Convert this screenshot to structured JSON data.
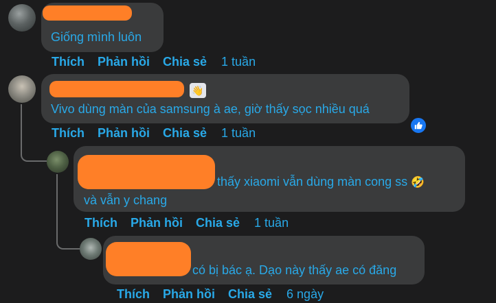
{
  "comments": [
    {
      "text_lines": [
        "Giống mình luôn"
      ],
      "actions": {
        "like": "Thích",
        "reply": "Phản hồi",
        "share": "Chia sẻ",
        "time": "1 tuần"
      }
    },
    {
      "text_lines": [
        "Vivo dùng màn của samsung à ae, giờ thấy sọc nhiều quá"
      ],
      "actions": {
        "like": "Thích",
        "reply": "Phản hồi",
        "share": "Chia sẻ",
        "time": "1 tuần"
      }
    },
    {
      "text_lines": [
        "thấy xiaomi vẫn dùng màn cong ss",
        "và vẫn y chang"
      ],
      "emoji": "🤣",
      "actions": {
        "like": "Thích",
        "reply": "Phản hồi",
        "share": "Chia sẻ",
        "time": "1 tuần"
      }
    },
    {
      "text_lines": [
        "có bị bác ạ. Dạo này thấy ae có đăng"
      ],
      "actions": {
        "like": "Thích",
        "reply": "Phản hồi",
        "share": "Chia sẻ",
        "time": "6 ngày"
      }
    }
  ],
  "icons": {
    "reaction_badge": "like-icon",
    "wave": "waving-hand-icon"
  },
  "colors": {
    "background": "#1c1c1d",
    "bubble": "#3a3b3c",
    "text": "#29a9e8",
    "redaction": "#ff7f27",
    "like_badge": "#1877f2"
  }
}
